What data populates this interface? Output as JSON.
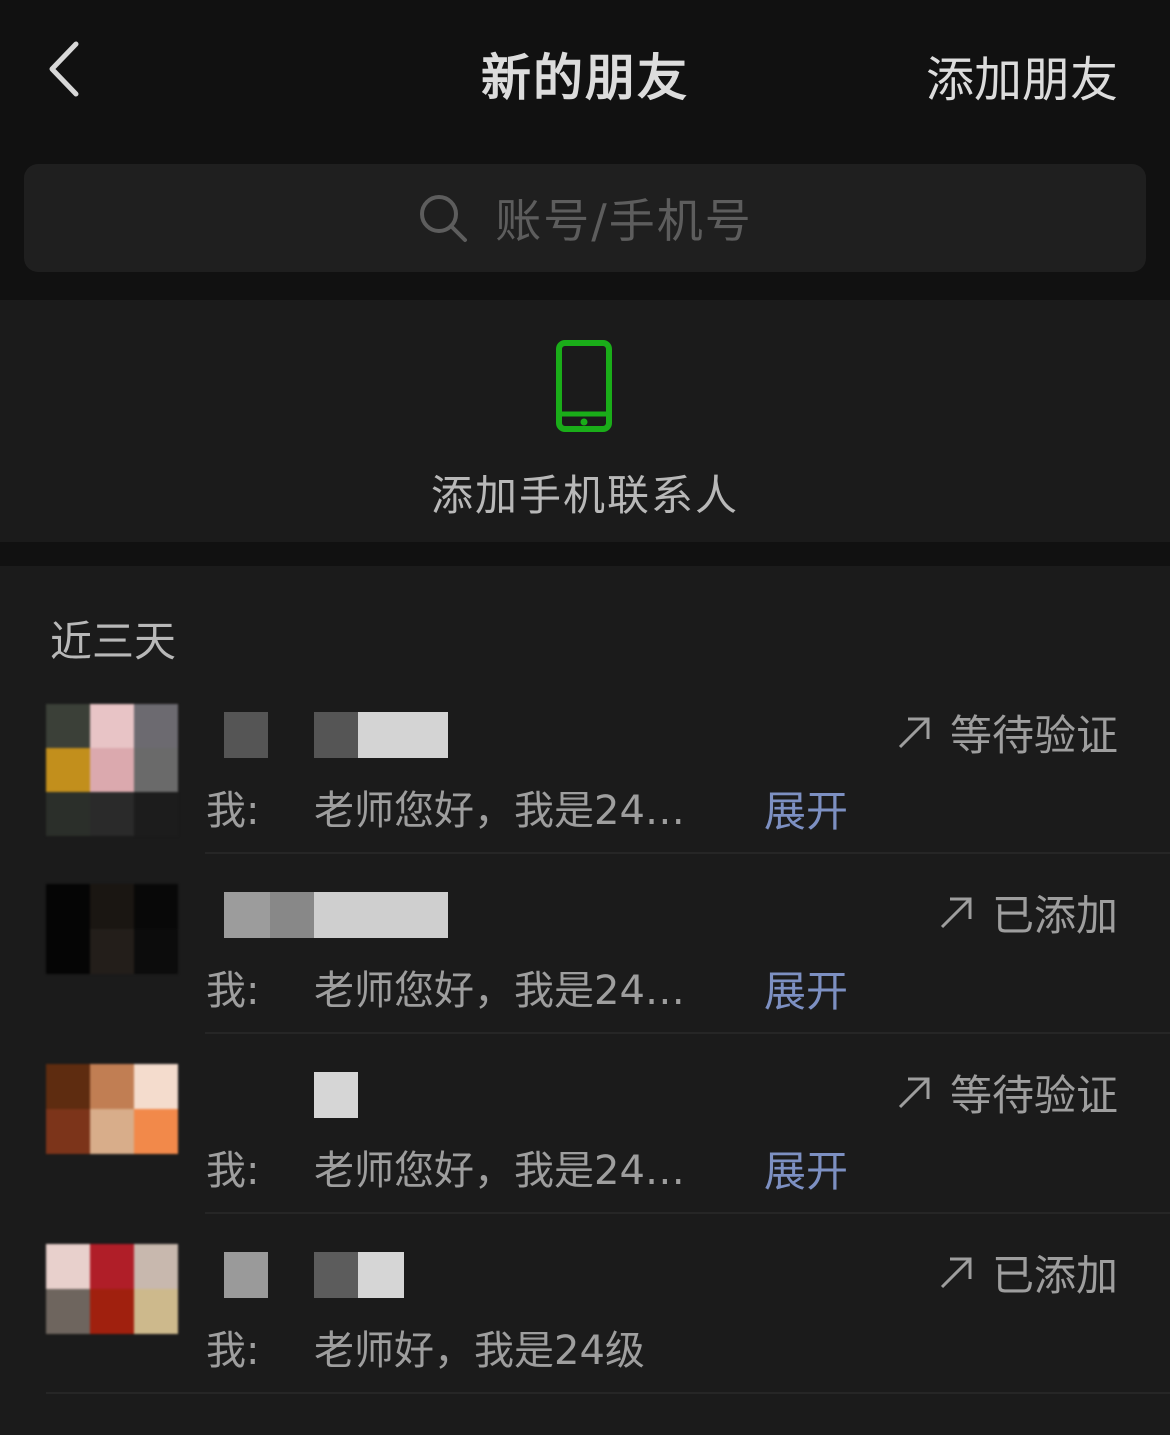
{
  "header": {
    "title": "新的朋友",
    "add_friend_label": "添加朋友"
  },
  "search": {
    "placeholder": "账号/手机号"
  },
  "phone_contacts": {
    "label": "添加手机联系人",
    "accent_color": "#1aad19"
  },
  "recent": {
    "section_title": "近三天",
    "items": [
      {
        "prefix": "我:",
        "message": "老师您好，我是24…",
        "expand_label": "展开",
        "status": "等待验证"
      },
      {
        "prefix": "我:",
        "message": "老师您好，我是24…",
        "expand_label": "展开",
        "status": "已添加"
      },
      {
        "prefix": "我:",
        "message": "老师您好，我是24…",
        "expand_label": "展开",
        "status": "等待验证"
      },
      {
        "prefix": "我:",
        "message": "老师好，我是24级",
        "expand_label": "",
        "status": "已添加"
      }
    ]
  }
}
